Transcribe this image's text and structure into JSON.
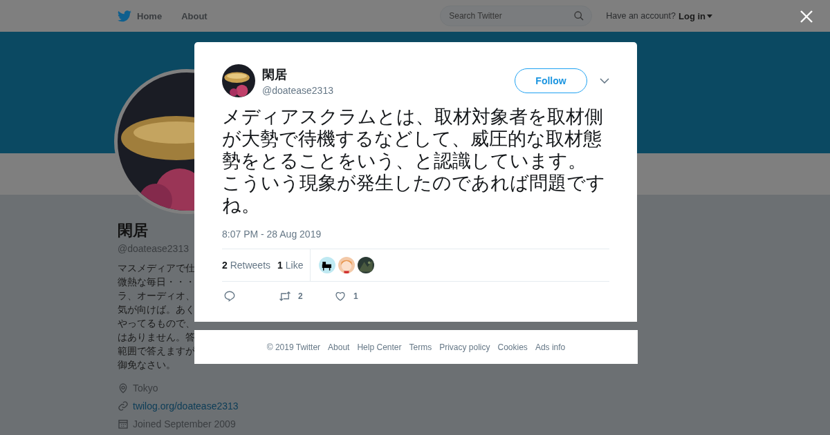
{
  "nav": {
    "items": [
      {
        "label": "Home",
        "kind": "home"
      },
      {
        "label": "About",
        "kind": "plain"
      }
    ],
    "search": {
      "placeholder": "Search Twitter"
    },
    "account_prompt": "Have an account?",
    "login": "Log in"
  },
  "profile": {
    "name": "閑居",
    "handle": "@doatease2313",
    "bio_lines": [
      "マスメディアで仕",
      "微熱な毎日・・・",
      "ラ、オーディオ、",
      "気が向けば。あく",
      "やってるもので、",
      "はありません。答",
      "範囲で答えますが",
      "御免なさい。"
    ],
    "location": "Tokyo",
    "link": "twilog.org/doatease2313",
    "joined": "Joined September 2009"
  },
  "tweet": {
    "name": "閑居",
    "handle": "@doatease2313",
    "follow": "Follow",
    "paragraphs": [
      "メディアスクラムとは、取材対象者を取材側が大勢で待機するなどして、威圧的な取材態勢をとることをいう、と認識しています。",
      "こういう現象が発生したのであれば問題ですね。"
    ],
    "time": "8:07 PM - 28 Aug 2019",
    "stats": [
      {
        "count": "2",
        "label": "Retweets"
      },
      {
        "count": "1",
        "label": "Like"
      }
    ],
    "liker_avatars": [
      {
        "kind": "picture"
      },
      {
        "kind": "picture"
      },
      {
        "kind": "picture"
      }
    ],
    "actions": [
      {
        "kind": "reply"
      },
      {
        "kind": "retweet",
        "count": "2"
      },
      {
        "kind": "like",
        "count": "1"
      }
    ]
  },
  "footer": {
    "links": [
      "© 2019 Twitter",
      "About",
      "Help Center",
      "Terms",
      "Privacy policy",
      "Cookies",
      "Ads info"
    ]
  }
}
